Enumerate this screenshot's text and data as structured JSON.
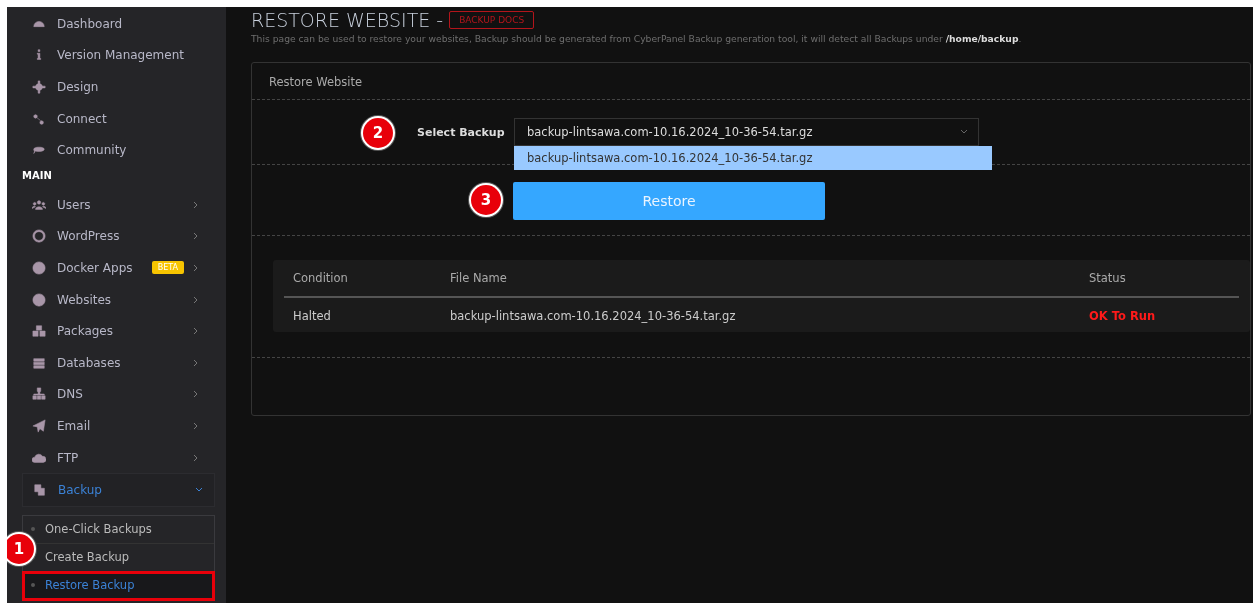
{
  "sidebar": {
    "items": [
      {
        "kind": "link",
        "label": "Dashboard"
      },
      {
        "kind": "link",
        "label": "Version Management"
      },
      {
        "kind": "link",
        "label": "Design"
      },
      {
        "kind": "link",
        "label": "Connect"
      },
      {
        "kind": "link",
        "label": "Community"
      },
      {
        "kind": "heading",
        "label": "MAIN"
      },
      {
        "kind": "group",
        "label": "Users"
      },
      {
        "kind": "group",
        "label": "WordPress"
      },
      {
        "kind": "group",
        "label": "Docker Apps",
        "badge": "BETA"
      },
      {
        "kind": "group",
        "label": "Websites"
      },
      {
        "kind": "group",
        "label": "Packages"
      },
      {
        "kind": "group",
        "label": "Databases"
      },
      {
        "kind": "group",
        "label": "DNS"
      },
      {
        "kind": "group",
        "label": "Email"
      },
      {
        "kind": "group",
        "label": "FTP"
      },
      {
        "kind": "group",
        "label": "Backup",
        "expanded": true,
        "children": [
          {
            "label": "One-Click Backups",
            "selected": false,
            "highlighted": false
          },
          {
            "label": "Create Backup",
            "selected": false,
            "highlighted": false
          },
          {
            "label": "Restore Backup",
            "selected": true,
            "highlighted": true
          }
        ]
      }
    ]
  },
  "page": {
    "title": "RESTORE WEBSITE -",
    "docs_button": "BACKUP DOCS",
    "description": "This page can be used to restore your websites, Backup should be generated from CyberPanel Backup generation tool, it will detect all Backups under **/home/backup**."
  },
  "card": {
    "title": "Restore Website",
    "select_label": "Select Backup",
    "select_value": "backup-lintsawa.com-10.16.2024_10-36-54.tar.gz",
    "options": [
      "backup-lintsawa.com-10.16.2024_10-36-54.tar.gz"
    ],
    "button": "Restore",
    "table": {
      "columns": [
        "Condition",
        "File Name",
        "Status"
      ],
      "rows": [
        [
          "Halted",
          "backup-lintsawa.com-10.16.2024_10-36-54.tar.gz",
          "OK To Run"
        ]
      ]
    }
  },
  "annotations": [
    "1",
    "2",
    "3"
  ]
}
